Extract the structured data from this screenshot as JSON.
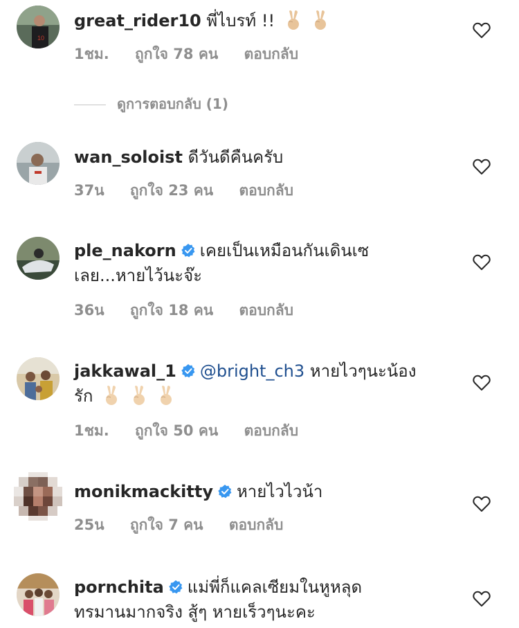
{
  "comments": [
    {
      "username": "great_rider10",
      "verified": false,
      "mention": "",
      "text": "พี่ไบรท์ !!",
      "emoji_count": 2,
      "time": "1ชม.",
      "likes": "ถูกใจ 78 คน",
      "reply": "ตอบกลับ",
      "view_replies": "ดูการตอบกลับ (1)"
    },
    {
      "username": "wan_soloist",
      "verified": false,
      "mention": "",
      "text": "ดีวันดีคืนครับ",
      "time": "37น",
      "likes": "ถูกใจ 23 คน",
      "reply": "ตอบกลับ"
    },
    {
      "username": "ple_nakorn",
      "verified": true,
      "mention": "",
      "text": "เคยเป็นเหมือนกันเดินเซ",
      "text2": "เลย...หายไว้นะจ๊ะ",
      "time": "36น",
      "likes": "ถูกใจ 18 คน",
      "reply": "ตอบกลับ"
    },
    {
      "username": "jakkawal_1",
      "verified": true,
      "mention": "@bright_ch3",
      "text": "หายไวๆนะน้อง",
      "text2": "รัก",
      "emoji_count": 3,
      "time": "1ชม.",
      "likes": "ถูกใจ 50 คน",
      "reply": "ตอบกลับ"
    },
    {
      "username": "monikmackitty",
      "verified": true,
      "mention": "",
      "text": "หายไวไวน้า",
      "time": "25น",
      "likes": "ถูกใจ 7 คน",
      "reply": "ตอบกลับ"
    },
    {
      "username": "pornchita",
      "verified": true,
      "mention": "",
      "text": "แม่พี่ก็แคลเซียมในหูหลุด",
      "text2": "ทรมานมากจริง สู้ๆ หายเร็วๆนะคะ",
      "time": "",
      "likes": "",
      "reply": ""
    }
  ],
  "icons": {
    "heart": "heart-outline-icon",
    "verified": "verified-badge-icon",
    "emoji": "victory-hand-emoji"
  },
  "colors": {
    "text": "#262626",
    "meta": "#8e8e8e",
    "verified": "#3897f0",
    "mention": "#1f4f8f"
  }
}
